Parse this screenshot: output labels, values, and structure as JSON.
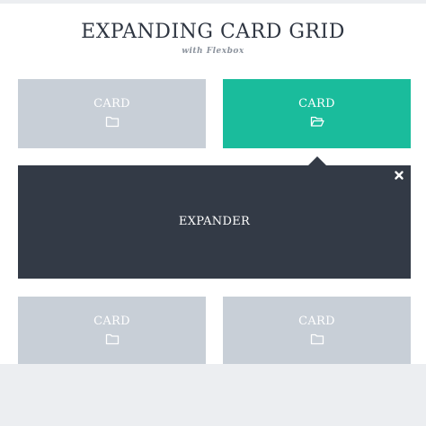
{
  "header": {
    "title": "EXPANDING CARD GRID",
    "subtitle": "with Flexbox"
  },
  "cards": [
    {
      "label": "CARD",
      "icon": "folder-icon",
      "state": "collapsed",
      "color": "#c8cfd7"
    },
    {
      "label": "CARD",
      "icon": "folder-open-icon",
      "state": "expanded",
      "color": "#1abc9c"
    },
    {
      "label": "CARD",
      "icon": "folder-icon",
      "state": "collapsed",
      "color": "#c8cfd7"
    },
    {
      "label": "CARD",
      "icon": "folder-icon",
      "state": "collapsed",
      "color": "#c8cfd7"
    }
  ],
  "expander": {
    "label": "EXPANDER",
    "close_icon": "close-icon",
    "color": "#333a46"
  },
  "colors": {
    "background": "#eceef1",
    "page": "#ffffff",
    "title": "#2f3642",
    "subtitle": "#8c939d"
  }
}
